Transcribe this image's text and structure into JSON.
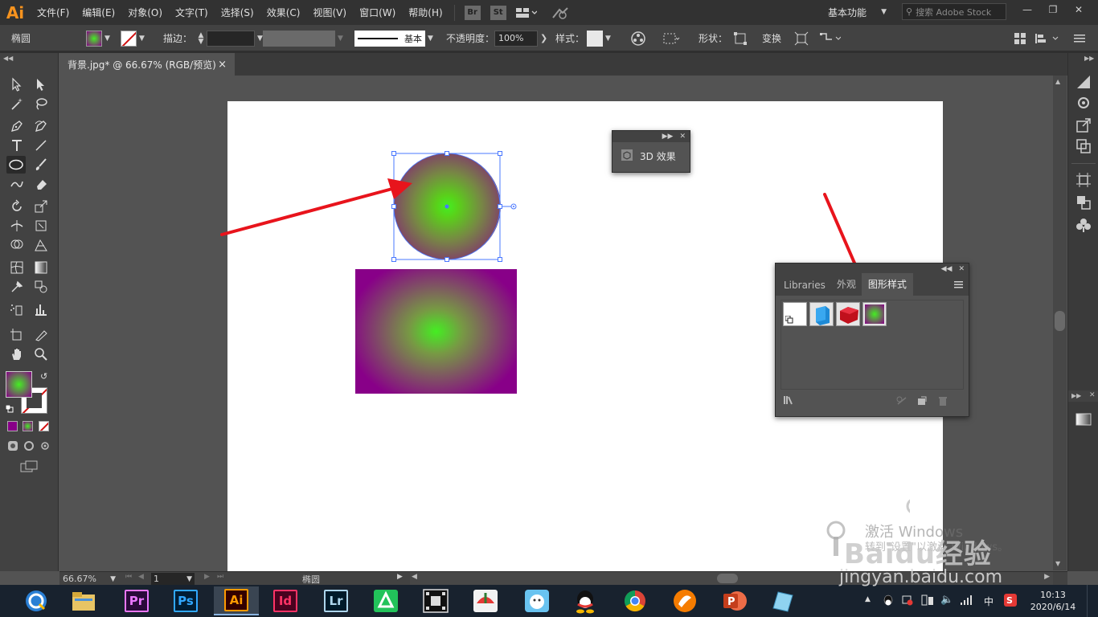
{
  "app": {
    "logo": "Ai"
  },
  "menu": [
    "文件(F)",
    "编辑(E)",
    "对象(O)",
    "文字(T)",
    "选择(S)",
    "效果(C)",
    "视图(V)",
    "窗口(W)",
    "帮助(H)"
  ],
  "app_badges": [
    "Br",
    "St"
  ],
  "workspace": "基本功能",
  "stock_search_placeholder": "搜索 Adobe Stock",
  "control": {
    "object_type": "椭圆",
    "stroke_label": "描边：",
    "stroke_style": "基本",
    "opacity_label": "不透明度：",
    "opacity_value": "100%",
    "style_label": "样式：",
    "shape_label": "形状：",
    "transform_label": "变换"
  },
  "document_tab": {
    "title": "背景.jpg* @ 66.67% (RGB/预览)",
    "close": "×"
  },
  "panel_3d": {
    "title": "3D 效果"
  },
  "panel_styles": {
    "tabs": [
      "Libraries",
      "外观",
      "图形样式"
    ],
    "active_tab": "图形样式"
  },
  "status": {
    "zoom": "66.67%",
    "artboard_num": "1",
    "current_tool": "椭圆"
  },
  "taskbar": {
    "apps": [
      "Pr",
      "Ps",
      "Ai",
      "Id",
      "Lr"
    ],
    "clock_time": "10:13",
    "clock_date": "2020/6/14",
    "ime": "中"
  },
  "watermark": {
    "activate": "激活 Windows",
    "goto": "转到\"设置\"以激活 Windows。",
    "brand": "Baidu经验",
    "url": "jingyan.baidu.com"
  },
  "colors": {
    "gradient_center": "#44ee22",
    "gradient_edge": "#880088",
    "arrow": "#e8141c",
    "selection": "#4a78ff"
  }
}
